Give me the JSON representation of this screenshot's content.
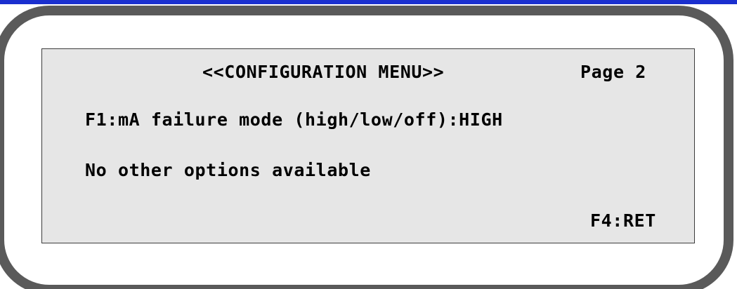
{
  "screen": {
    "header_title": "<<CONFIGURATION MENU>>",
    "page_label": "Page 2",
    "option_f1": "F1:mA failure mode (high/low/off):HIGH",
    "info_line": "No other options available",
    "soft_key_return": "F4:RET"
  },
  "colors": {
    "top_bar": "#1a2fcf",
    "bezel": "#5a5a5a",
    "lcd_background": "#e6e6e6",
    "lcd_text": "#000000"
  }
}
